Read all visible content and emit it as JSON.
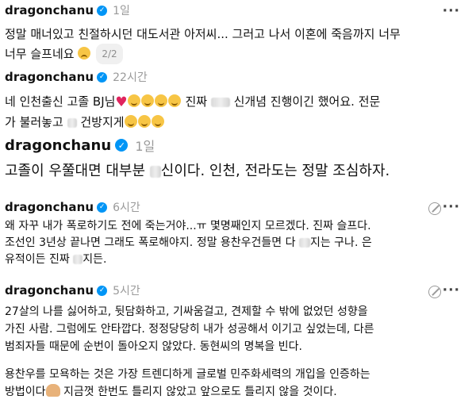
{
  "posts": [
    {
      "username": "dragonchanu",
      "time": "1일",
      "lines": [
        "정말 매너있고 친절하시던 대도서관 아저씨... 그러고 나서 이혼에 죽음까지 너무",
        "너무 슬프네요"
      ],
      "pager": "2/2"
    },
    {
      "username": "dragonchanu",
      "time": "22시간",
      "line1_a": "네 인천출신 고졸 BJ님",
      "line1_b": "진짜",
      "line1_c": "신개념 진행이긴 했어요. 전문",
      "line2_a": "가 불러놓고",
      "line2_b": "건방지게"
    },
    {
      "username": "dragonchanu",
      "time": "1일",
      "line_a": "고졸이 우쭐대면 대부분",
      "line_b": "신이다. 인천, 전라도는 정말 조심하자."
    },
    {
      "username": "dragonchanu",
      "time": "6시간",
      "line1": "왜 자꾸 내가 폭로하기도 전에 죽는거야...ㅠ 몇명째인지 모르겠다. 진짜 슬프다.",
      "line2_a": "조선인 3년상 끝나면 그래도 폭로해야지. 정말 용찬우건들면 다",
      "line2_b": "지는 구나. 은",
      "line3_a": "유적이든 진짜",
      "line3_b": "지든."
    },
    {
      "username": "dragonchanu",
      "time": "5시간",
      "lines": [
        "27살의 나를 싫어하고, 뒷담화하고, 기싸움걸고, 견제할 수 밖에 없었던 성향을",
        "가진 사람. 그럼에도 안타깝다. 정정당당히 내가 성공해서 이기고 싶었는데, 다른",
        "범죄자들 때문에 순번이 돌아오지 않았다. 동현씨의 명복을 빈다."
      ],
      "para2_line1": "용찬우를 모욕하는 것은 가장 트렌디하게 글로벌 민주화세력의 개입을 인증하는",
      "para2_line2_a": "방법이다",
      "para2_line2_b": "지금껏 한번도 틀리지 않았고 앞으로도 틀리지 않을 것이다."
    }
  ],
  "icons": {
    "verified": "verified-badge-icon",
    "more": "more-options-icon",
    "edit": "edited-icon"
  },
  "colors": {
    "verified": "#0095f6",
    "time": "#9a9a9a"
  }
}
